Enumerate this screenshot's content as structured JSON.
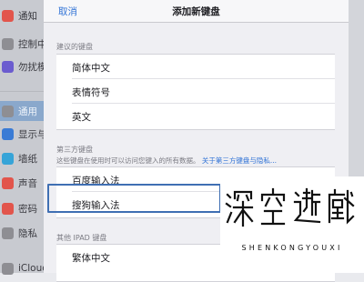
{
  "sidebar": {
    "items": [
      {
        "label": "通知",
        "icon": "notification-icon",
        "color": "#e2554c"
      },
      {
        "label": "控制中心",
        "icon": "control-center-icon",
        "color": "#8e8e93"
      },
      {
        "label": "勿扰模式",
        "icon": "do-not-disturb-icon",
        "color": "#6b5ccf"
      },
      {
        "label": "通用",
        "icon": "gear-icon",
        "color": "#8e8e93",
        "active": true
      },
      {
        "label": "显示与亮度",
        "icon": "display-brightness-icon",
        "color": "#3a7bd5"
      },
      {
        "label": "墙纸",
        "icon": "wallpaper-icon",
        "color": "#36a4d8"
      },
      {
        "label": "声音",
        "icon": "sound-icon",
        "color": "#e2554c"
      },
      {
        "label": "密码",
        "icon": "passcode-icon",
        "color": "#e2554c"
      },
      {
        "label": "隐私",
        "icon": "privacy-hand-icon",
        "color": "#8e8e93"
      },
      {
        "label": "iCloud",
        "icon": "icloud-icon",
        "color": "#8e8e93"
      }
    ]
  },
  "modal": {
    "cancel_label": "取消",
    "title": "添加新键盘",
    "suggested": {
      "header": "建议的键盘",
      "items": [
        "简体中文",
        "表情符号",
        "英文"
      ]
    },
    "third_party": {
      "header": "第三方键盘",
      "description": "这些键盘在使用时可以访问您键入的所有数据。",
      "link": "关于第三方键盘与隐私...",
      "items": [
        "百度输入法",
        "搜狗输入法"
      ],
      "highlighted": "搜狗输入法"
    },
    "other": {
      "header": "其他 IPAD 键盘",
      "items": [
        "繁体中文"
      ]
    }
  },
  "watermark": {
    "chars": [
      "深",
      "空",
      "游",
      "戏"
    ],
    "subtitle": "SHENKONGYOUXI"
  },
  "colors": {
    "accent": "#2f72d6",
    "highlight_border": "#3f6fb3",
    "active_row": "#8aa8cc"
  }
}
